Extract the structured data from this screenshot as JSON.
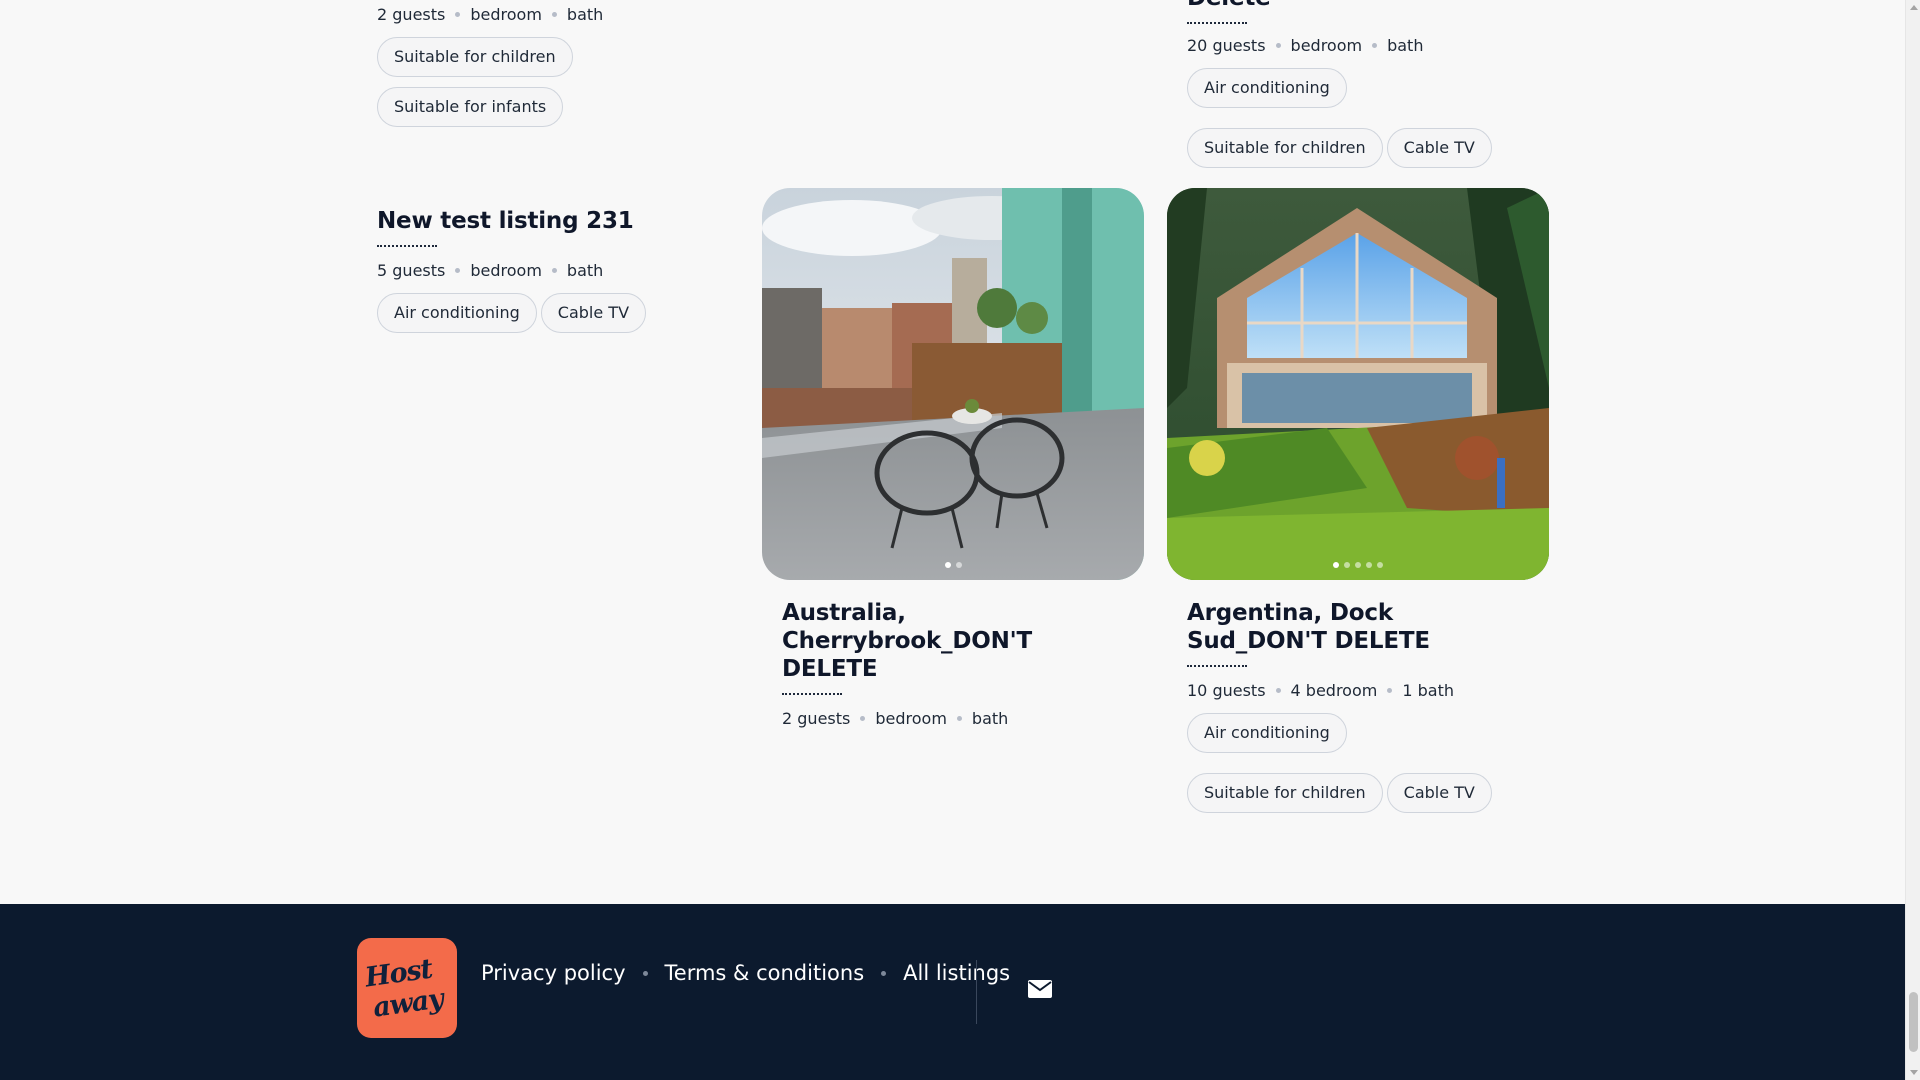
{
  "listings": {
    "top_left": {
      "meta": [
        "2 guests",
        "bedroom",
        "bath"
      ],
      "tags": [
        "Suitable for children",
        "Suitable for infants"
      ]
    },
    "top_right": {
      "title_tail": "Delete",
      "meta": [
        "20 guests",
        "bedroom",
        "bath"
      ],
      "tags": [
        "Air conditioning",
        "Suitable for children",
        "Cable TV"
      ]
    },
    "new_test": {
      "title": "New test listing 231",
      "meta": [
        "5 guests",
        "bedroom",
        "bath"
      ],
      "tags": [
        "Air conditioning",
        "Cable TV"
      ]
    },
    "australia": {
      "title": "Australia, Cherrybrook_DON'T DELETE",
      "meta": [
        "2 guests",
        "bedroom",
        "bath"
      ],
      "tags": [],
      "photo_index": 1,
      "photo_count": 2
    },
    "argentina": {
      "title": "Argentina, Dock Sud_DON'T DELETE",
      "meta": [
        "10 guests",
        "4 bedroom",
        "1 bath"
      ],
      "tags": [
        "Air conditioning",
        "Suitable for children",
        "Cable TV"
      ],
      "photo_index": 1,
      "photo_count": 5
    }
  },
  "footer": {
    "logo_line1": "Host",
    "logo_line2": "away",
    "links": [
      "Privacy policy",
      "Terms & conditions",
      "All listings"
    ],
    "icons": [
      "mail-icon"
    ]
  },
  "colors": {
    "background": "#f8f8f8",
    "footer_bg": "#0c1a2e",
    "logo_bg": "#f36b4a",
    "text": "#0f172a"
  }
}
